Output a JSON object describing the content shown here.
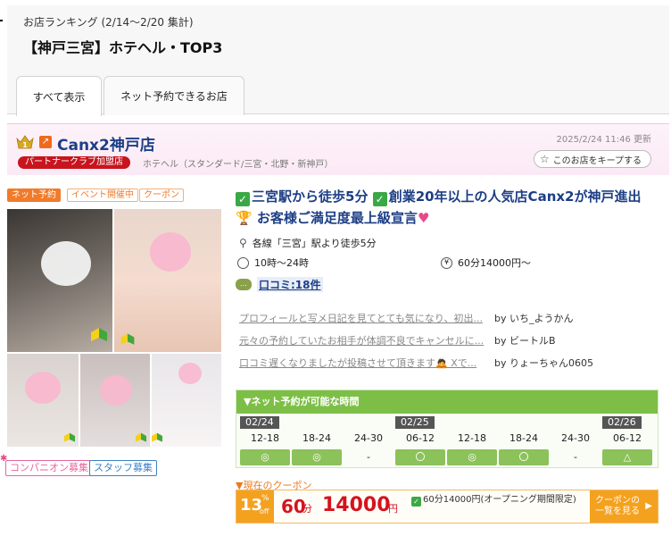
{
  "ranking": {
    "period": "お店ランキング (2/14〜2/20 集計)",
    "title": "【神戸三宮】ホテヘル・TOP3"
  },
  "tabs": [
    {
      "label": "すべて表示",
      "active": true
    },
    {
      "label": "ネット予約できるお店",
      "active": false
    }
  ],
  "shop": {
    "rank": 1,
    "name": "Canx2神戸店",
    "partner_badge": "パートナークラブ加盟店",
    "category": "ホテヘル（スタンダード/三宮・北野・新神戸）",
    "updated": "2025/2/24 11:46 更新",
    "keep_label": "このお店をキープする"
  },
  "tags": [
    "ネット予約",
    "イベント開催中",
    "クーポン"
  ],
  "recruit": [
    "コンパニオン募集",
    "スタッフ募集"
  ],
  "headline": {
    "part1": "三宮駅から徒歩5分",
    "part2": "創業20年以上の人気店Canx2が神戸進出",
    "part3": "お客様ご満足度最上級宣言"
  },
  "info": {
    "access": "各線「三宮」駅より徒歩5分",
    "hours": "10時〜24時",
    "price": "60分14000円〜",
    "reviews": "口コミ:18件"
  },
  "reviews": [
    {
      "text": "プロフィールと写メ日記を見てとても気になり、初出...",
      "by": "by いち_ようかん"
    },
    {
      "text": "元々の予約していたお相手が体調不良でキャンセルに...",
      "by": "by ビートルB"
    },
    {
      "text": "口コミ遅くなりましたが投稿させて頂きます🙇 Xで...",
      "by": "by りょーちゃん0605"
    }
  ],
  "schedule": {
    "title": "▼ネット予約が可能な時間",
    "dates": [
      "02/24",
      "02/25",
      "02/26"
    ],
    "slots": [
      "12-18",
      "18-24",
      "24-30",
      "06-12",
      "12-18",
      "18-24",
      "24-30",
      "06-12"
    ],
    "marks": [
      "◎",
      "◎",
      "-",
      "〇",
      "◎",
      "〇",
      "-",
      "△"
    ]
  },
  "coupon": {
    "title": "▼現在のクーポン",
    "percent": "13",
    "percent_sign": "%",
    "off": "off",
    "minutes": "60",
    "minutes_unit": "分",
    "price": "14000",
    "yen": "円",
    "desc": "60分14000円(オープニング期間限定)",
    "button": "クーポンの一覧を見る"
  },
  "colors": {
    "accent_navy": "#1d3e86",
    "partner_red": "#c8141e",
    "schedule_green": "#7dbf46",
    "coupon_orange": "#f4a120"
  }
}
